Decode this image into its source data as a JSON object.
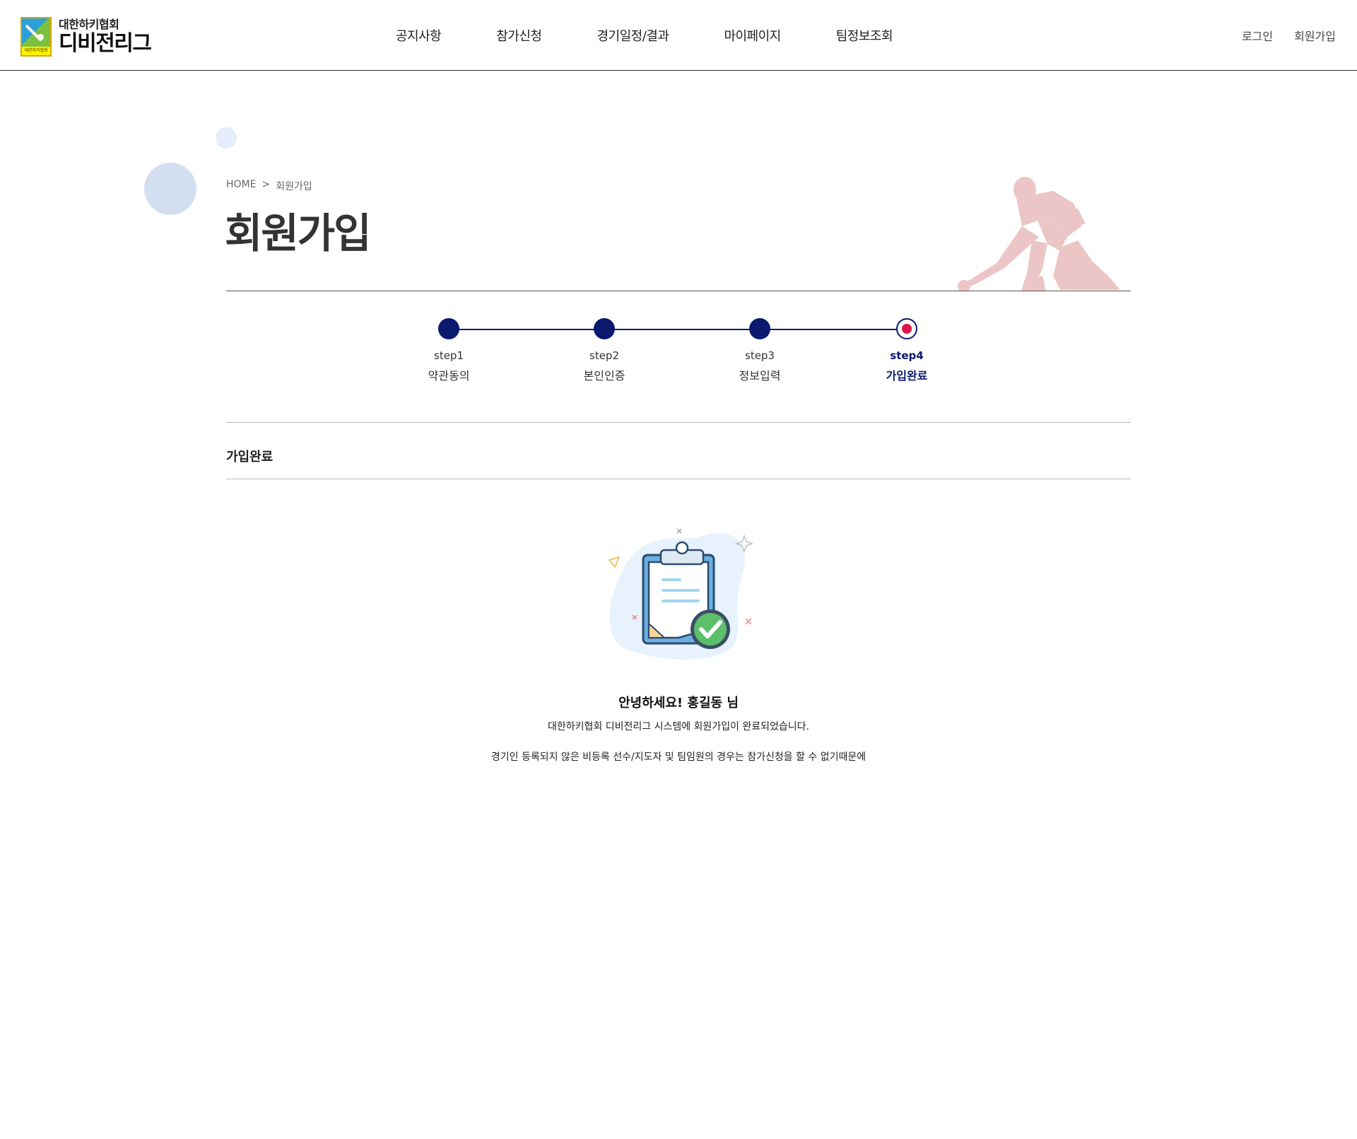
{
  "header": {
    "logo": {
      "sub": "대한하키협회",
      "main": "디비전리그",
      "badge_text": "대한하키협회",
      "badge_colors": [
        "#2aa0d8",
        "#7cc142",
        "#fff200",
        "#e0a400"
      ]
    },
    "nav": [
      {
        "label": "공지사항"
      },
      {
        "label": "참가신청"
      },
      {
        "label": "경기일정/결과"
      },
      {
        "label": "마이페이지"
      },
      {
        "label": "팀정보조회"
      }
    ],
    "util": {
      "login": "로그인",
      "signup": "회원가입"
    }
  },
  "breadcrumb": {
    "home": "HOME",
    "separator": ">",
    "current": "회원가입"
  },
  "page_title": "회원가입",
  "steps": [
    {
      "num": "step1",
      "label": "약관동의",
      "state": "done"
    },
    {
      "num": "step2",
      "label": "본인인증",
      "state": "done"
    },
    {
      "num": "step3",
      "label": "정보입력",
      "state": "done"
    },
    {
      "num": "step4",
      "label": "가입완료",
      "state": "current"
    }
  ],
  "section_title": "가입완료",
  "illustration_icon": "clipboard-check-icon",
  "result": {
    "greeting": "안녕하세요! 홍길동 님",
    "message": "대한하키협회 디비전리그 시스템에 회원가입이 완료되었습니다.",
    "notice": "경기인 등록되지 않은 비등록 선수/지도자 및 팀임원의 경우는 참가신청을 할 수 없기때문에"
  },
  "colors": {
    "primary": "#0b1a6e",
    "accent": "#e2154a",
    "player_silhouette": "#ecc6c6"
  }
}
